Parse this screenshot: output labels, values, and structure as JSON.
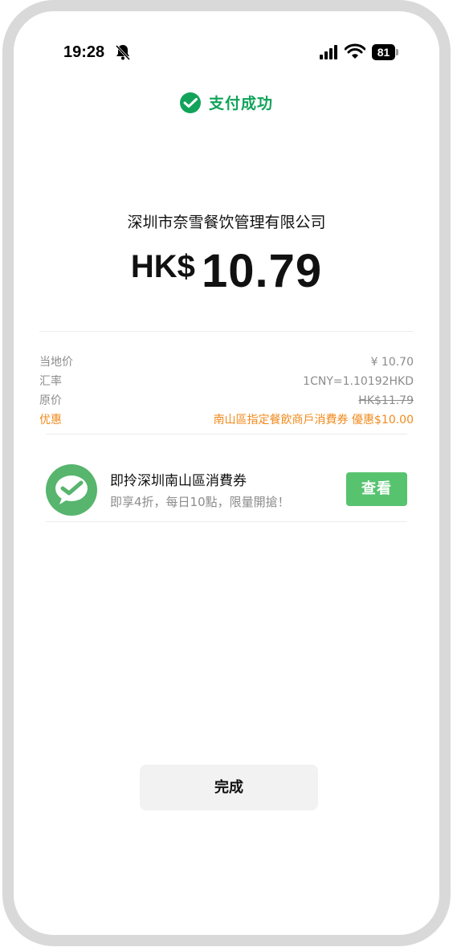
{
  "status_bar": {
    "time": "19:28",
    "battery_level": "81"
  },
  "payment": {
    "success_text": "支付成功",
    "merchant": "深圳市奈雪餐饮管理有限公司",
    "currency": "HK$",
    "amount": "10.79"
  },
  "details": [
    {
      "label": "当地价",
      "value": "¥ 10.70"
    },
    {
      "label": "汇率",
      "value": "1CNY=1.10192HKD"
    },
    {
      "label": "原价",
      "value": "HK$11.79"
    },
    {
      "label": "优惠",
      "value": "南山區指定餐飲商戶消費券 優惠$10.00"
    }
  ],
  "promo": {
    "title": "即拎深圳南山區消費券",
    "subtitle": "即享4折，每日10點，限量開搶！",
    "button_label": "查看"
  },
  "done_button": {
    "label": "完成"
  },
  "colors": {
    "wechat_green": "#12a35a",
    "button_green": "#57c36f",
    "discount_orange": "#f08a1c"
  },
  "icons": {
    "status": [
      "bell-muted-icon",
      "cellular-signal-icon",
      "wifi-icon",
      "battery-icon"
    ],
    "success": "wechat-pay-check-icon",
    "promo": "wechat-pay-logo-icon"
  }
}
